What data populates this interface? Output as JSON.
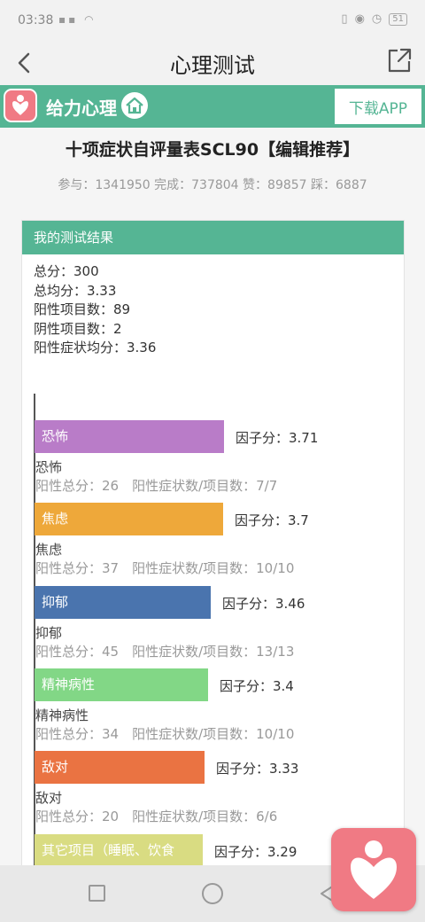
{
  "status_bar": {
    "time": "03:38",
    "battery": "51"
  },
  "nav": {
    "title": "心理测试"
  },
  "brand": {
    "name": "给力心理",
    "download_label": "下载APP"
  },
  "test": {
    "title": "十项症状自评量表SCL90【编辑推荐】",
    "stats": "参与：1341950 完成：737804 赞：89857 踩：6887"
  },
  "result": {
    "header": "我的测试结果",
    "summary": [
      "总分：300",
      "总均分：3.33",
      "阳性项目数：89",
      "阴性项目数：2",
      "阳性症状均分：3.36"
    ]
  },
  "chart_data": {
    "type": "bar",
    "orientation": "horizontal",
    "categories": [
      "恐怖",
      "焦虑",
      "抑郁",
      "精神病性",
      "敌对",
      "其它项目（睡眠、饮食"
    ],
    "values": [
      3.71,
      3.7,
      3.46,
      3.4,
      3.33,
      3.29
    ],
    "colors": [
      "#b97cc8",
      "#eea83a",
      "#4a74ae",
      "#82d786",
      "#ea7342",
      "#d9dc82"
    ],
    "score_labels": [
      "因子分：3.71",
      "因子分：3.7",
      "因子分：3.46",
      "因子分：3.4",
      "因子分：3.33",
      "因子分：3.29"
    ],
    "names": [
      "恐怖",
      "焦虑",
      "抑郁",
      "精神病性",
      "敌对",
      "其它项目（睡眠、饮食"
    ],
    "details": [
      "阳性总分：26　阳性症状数/项目数：7/7",
      "阳性总分：37　阳性症状数/项目数：10/10",
      "阳性总分：45　阳性症状数/项目数：13/13",
      "阳性总分：34　阳性症状数/项目数：10/10",
      "阳性总分：20　阳性症状数/项目数：6/6",
      ""
    ]
  }
}
